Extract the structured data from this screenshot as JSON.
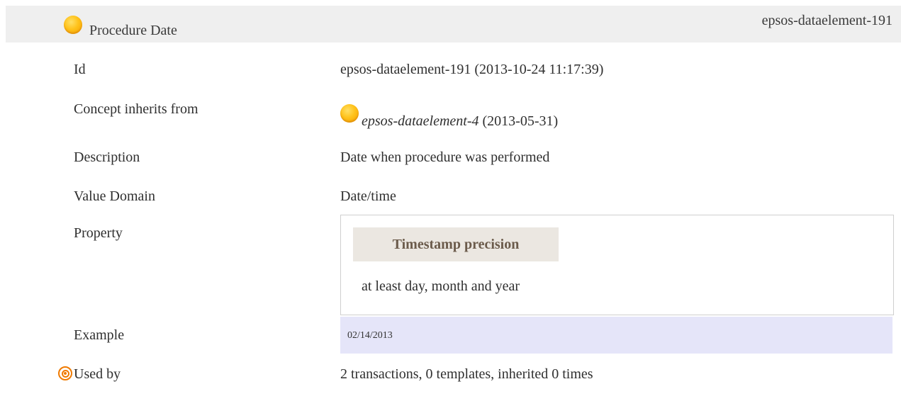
{
  "header": {
    "title": "Procedure Date",
    "id": "epsos-dataelement-191",
    "icon": "concept-dot-icon",
    "icon_color": "#ffc21a"
  },
  "rows": {
    "id": {
      "label": "Id",
      "value": "epsos-dataelement-191 (2013-10-24 11:17:39)"
    },
    "inherits": {
      "label": "Concept inherits from",
      "link": "epsos-dataelement-4",
      "date": "(2013-05-31)"
    },
    "description": {
      "label": "Description",
      "value": "Date when procedure was performed"
    },
    "value_domain": {
      "label": "Value Domain",
      "value": "Date/time"
    },
    "property": {
      "label": "Property",
      "name": "Timestamp precision",
      "value": "at least day, month and year"
    },
    "example": {
      "label": "Example",
      "value": "02/14/2013"
    },
    "used_by": {
      "label": "Used by",
      "value": "2 transactions, 0 templates, inherited 0 times",
      "icon": "target-icon",
      "icon_color": "#f07a00"
    }
  },
  "colors": {
    "header_bg": "#efefef",
    "property_header_bg": "#ebe7e1",
    "example_bg": "#e5e5f9"
  }
}
